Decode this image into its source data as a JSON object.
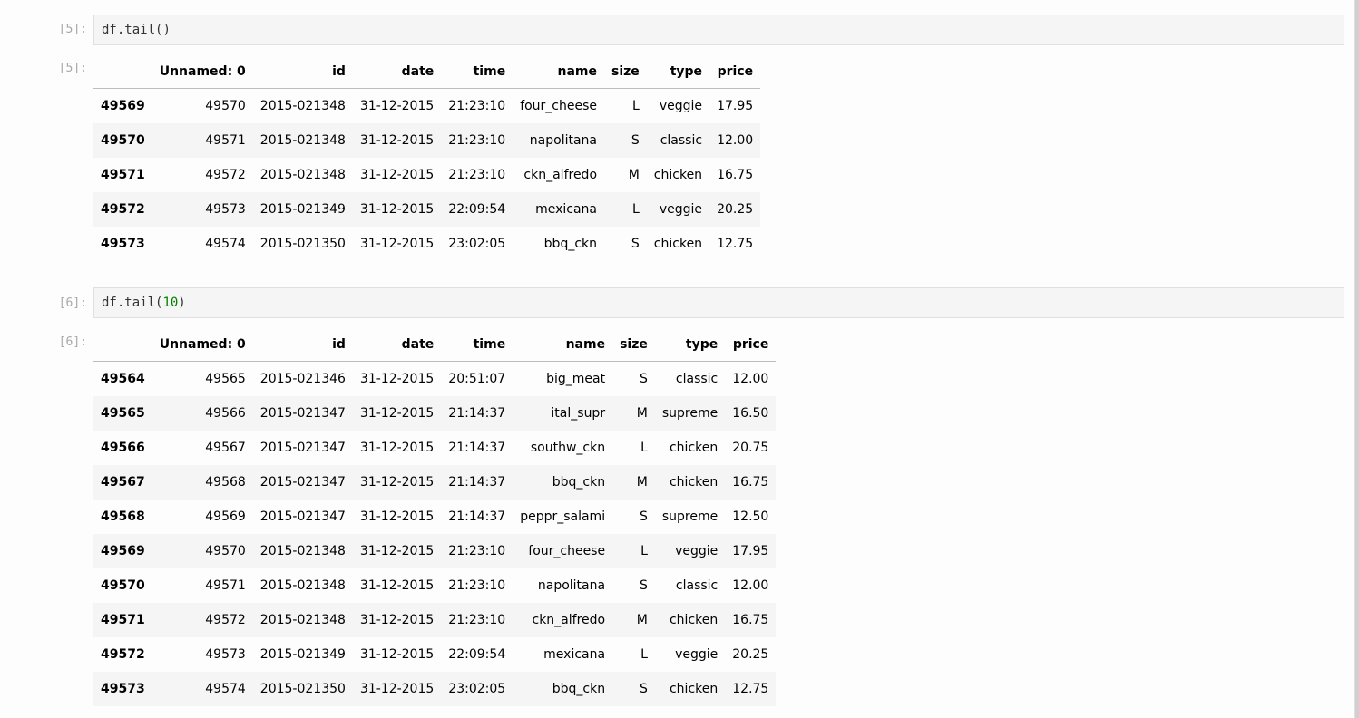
{
  "columns": [
    "",
    "Unnamed: 0",
    "id",
    "date",
    "time",
    "name",
    "size",
    "type",
    "price"
  ],
  "cells": [
    {
      "prompt_in": "[5]:",
      "code": "df.tail(",
      "code_arg": "",
      "code_end": ")",
      "prompt_out": "[5]:",
      "rows": [
        [
          "49569",
          "49570",
          "2015-021348",
          "31-12-2015",
          "21:23:10",
          "four_cheese",
          "L",
          "veggie",
          "17.95"
        ],
        [
          "49570",
          "49571",
          "2015-021348",
          "31-12-2015",
          "21:23:10",
          "napolitana",
          "S",
          "classic",
          "12.00"
        ],
        [
          "49571",
          "49572",
          "2015-021348",
          "31-12-2015",
          "21:23:10",
          "ckn_alfredo",
          "M",
          "chicken",
          "16.75"
        ],
        [
          "49572",
          "49573",
          "2015-021349",
          "31-12-2015",
          "22:09:54",
          "mexicana",
          "L",
          "veggie",
          "20.25"
        ],
        [
          "49573",
          "49574",
          "2015-021350",
          "31-12-2015",
          "23:02:05",
          "bbq_ckn",
          "S",
          "chicken",
          "12.75"
        ]
      ]
    },
    {
      "prompt_in": "[6]:",
      "code": "df.tail(",
      "code_arg": "10",
      "code_end": ")",
      "prompt_out": "[6]:",
      "rows": [
        [
          "49564",
          "49565",
          "2015-021346",
          "31-12-2015",
          "20:51:07",
          "big_meat",
          "S",
          "classic",
          "12.00"
        ],
        [
          "49565",
          "49566",
          "2015-021347",
          "31-12-2015",
          "21:14:37",
          "ital_supr",
          "M",
          "supreme",
          "16.50"
        ],
        [
          "49566",
          "49567",
          "2015-021347",
          "31-12-2015",
          "21:14:37",
          "southw_ckn",
          "L",
          "chicken",
          "20.75"
        ],
        [
          "49567",
          "49568",
          "2015-021347",
          "31-12-2015",
          "21:14:37",
          "bbq_ckn",
          "M",
          "chicken",
          "16.75"
        ],
        [
          "49568",
          "49569",
          "2015-021347",
          "31-12-2015",
          "21:14:37",
          "peppr_salami",
          "S",
          "supreme",
          "12.50"
        ],
        [
          "49569",
          "49570",
          "2015-021348",
          "31-12-2015",
          "21:23:10",
          "four_cheese",
          "L",
          "veggie",
          "17.95"
        ],
        [
          "49570",
          "49571",
          "2015-021348",
          "31-12-2015",
          "21:23:10",
          "napolitana",
          "S",
          "classic",
          "12.00"
        ],
        [
          "49571",
          "49572",
          "2015-021348",
          "31-12-2015",
          "21:23:10",
          "ckn_alfredo",
          "M",
          "chicken",
          "16.75"
        ],
        [
          "49572",
          "49573",
          "2015-021349",
          "31-12-2015",
          "22:09:54",
          "mexicana",
          "L",
          "veggie",
          "20.25"
        ],
        [
          "49573",
          "49574",
          "2015-021350",
          "31-12-2015",
          "23:02:05",
          "bbq_ckn",
          "S",
          "chicken",
          "12.75"
        ]
      ]
    }
  ]
}
